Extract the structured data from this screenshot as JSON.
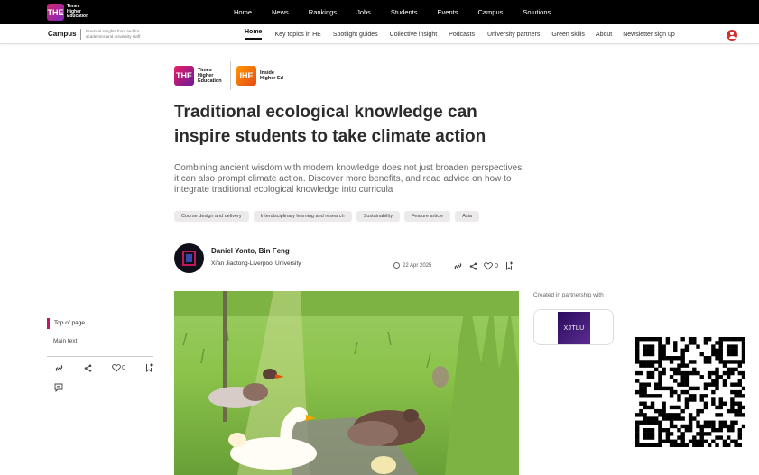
{
  "brand": {
    "mark": "THE",
    "name": "Times Higher Education"
  },
  "topnav": [
    "Home",
    "News",
    "Rankings",
    "Jobs",
    "Students",
    "Events",
    "Campus",
    "Solutions"
  ],
  "campus": {
    "title": "Campus",
    "tagline": "Practical insights from and for academics and university staff"
  },
  "subnav": [
    {
      "label": "Home",
      "active": true
    },
    {
      "label": "Key topics in HE"
    },
    {
      "label": "Spotlight guides"
    },
    {
      "label": "Collective insight"
    },
    {
      "label": "Podcasts"
    },
    {
      "label": "University partners"
    },
    {
      "label": "Green skills"
    },
    {
      "label": "About"
    },
    {
      "label": "Newsletter sign up"
    }
  ],
  "logos": {
    "the_mark": "THE",
    "the_text": "Times Higher Education",
    "ihe_mark": "IHE",
    "ihe_text": "Inside Higher Ed"
  },
  "article": {
    "headline": "Traditional ecological knowledge can inspire students to take climate action",
    "standfirst": "Combining ancient wisdom with modern knowledge does not just broaden perspectives, it can also prompt climate action. Discover more benefits, and read advice on how to integrate traditional ecological knowledge into curricula",
    "tags": [
      "Course design and delivery",
      "Interdisciplinary learning and research",
      "Sustainability",
      "Feature article",
      "Asia"
    ],
    "authors": "Daniel Yonto, Bin Feng",
    "institution": "Xi'an Jiaotong-Liverpool University",
    "date": "22 Apr 2025",
    "likes": "0"
  },
  "partner": {
    "label": "Created in partnership with",
    "name": "XJTLU"
  },
  "sidebar": {
    "top_of_page": "Top of page",
    "main_text": "Main text",
    "likes": "0"
  },
  "colors": {
    "accent": "#c2185b",
    "topbar": "#000000",
    "user": "#d32f2f"
  }
}
